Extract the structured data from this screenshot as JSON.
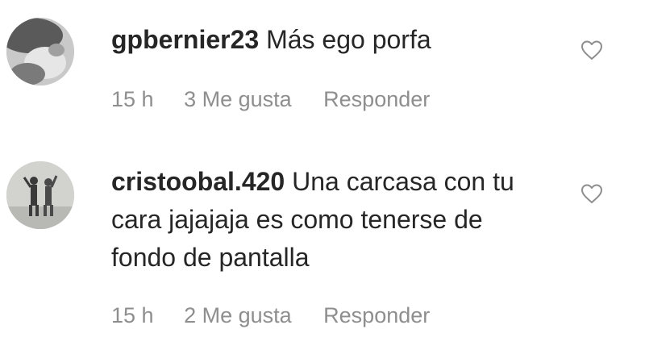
{
  "comments": [
    {
      "username": "gpbernier23",
      "text": "Más ego porfa",
      "time": "15 h",
      "likes": "3 Me gusta",
      "reply_label": "Responder",
      "avatar_icon": "user-avatar-photo",
      "like_icon": "heart-outline-icon"
    },
    {
      "username": "cristoobal.420",
      "text": "Una carcasa con tu cara jajajaja es como tenerse de fondo de pantalla",
      "time": "15 h",
      "likes": "2 Me gusta",
      "reply_label": "Responder",
      "avatar_icon": "user-avatar-photo",
      "like_icon": "heart-outline-icon"
    }
  ]
}
